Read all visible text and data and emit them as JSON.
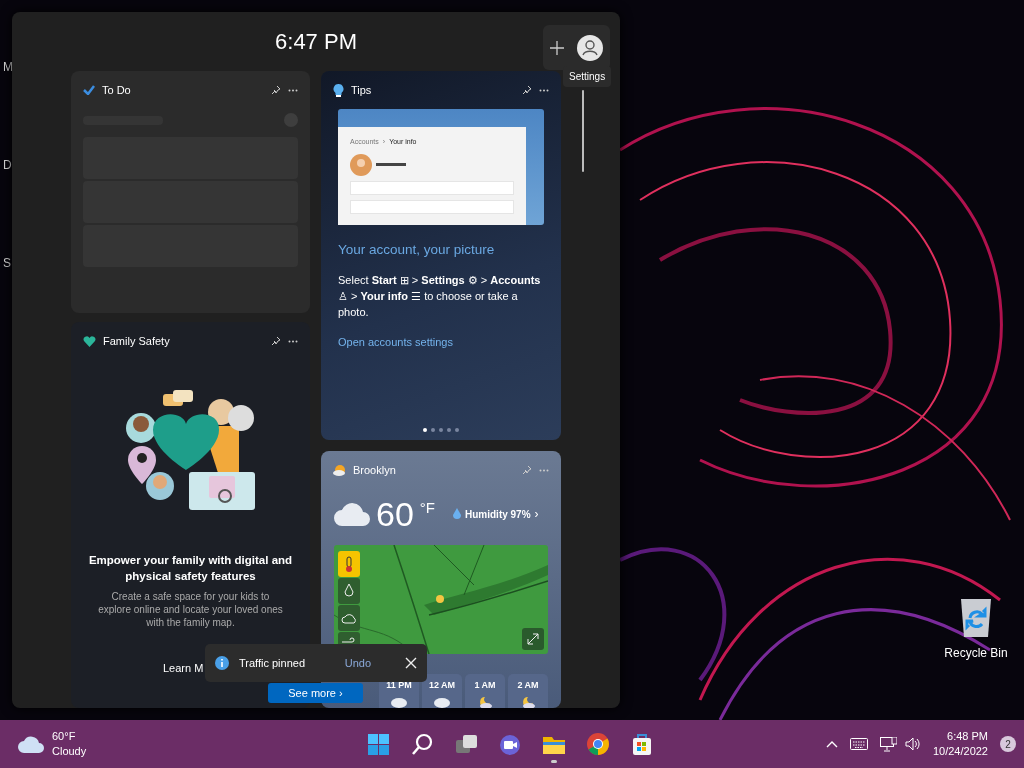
{
  "desktop": {
    "cut_labels": [
      "M",
      "D",
      "S"
    ],
    "icons": [
      {
        "label": "Recycle Bin"
      }
    ]
  },
  "widgets_panel": {
    "time": "6:47 PM",
    "tooltip": "Settings",
    "columns": [
      {
        "widgets": [
          {
            "kind": "todo",
            "title": "To Do"
          },
          {
            "kind": "family",
            "title": "Family Safety",
            "heading": "Empower your family with digital and physical safety features",
            "body": "Create a safe space for your kids to explore online and locate your loved ones with the family map.",
            "link": "Learn M",
            "button": "See more ›"
          }
        ]
      },
      {
        "widgets": [
          {
            "kind": "tips",
            "title": "Tips",
            "shot_crumb": "Accounts",
            "shot_sep": "›",
            "shot_page": "Your info",
            "headline": "Your account, your picture",
            "body": "Select **Start** ⊞ > **Settings** ⚙ > **Accounts** ♙ > **Your info** ☰ to choose or take a photo.",
            "link": "Open accounts settings",
            "pages": [
              {
                "selected": true
              },
              {
                "selected": false
              },
              {
                "selected": false
              },
              {
                "selected": false
              },
              {
                "selected": false
              }
            ]
          },
          {
            "kind": "weather",
            "title": "Brooklyn",
            "temp": "60",
            "unit": "°F",
            "humidity": "Humidity 97%",
            "chevron": "›",
            "map_layers": [
              {
                "kind": "temperature",
                "selected": true
              },
              {
                "kind": "precipitation",
                "selected": false
              },
              {
                "kind": "cloud",
                "selected": false
              },
              {
                "kind": "wind",
                "selected": false
              }
            ],
            "hourly": [
              {
                "time": "11 PM",
                "kind": "cloudy"
              },
              {
                "time": "12 AM",
                "kind": "cloudy"
              },
              {
                "time": "1 AM",
                "kind": "night"
              },
              {
                "time": "2 AM",
                "kind": "night"
              }
            ]
          }
        ]
      }
    ]
  },
  "toast": {
    "message": "Traffic pinned",
    "action": "Undo"
  },
  "taskbar": {
    "weather": {
      "temp": "60°F",
      "condition": "Cloudy"
    },
    "apps": [
      {
        "kind": "start",
        "running": false
      },
      {
        "kind": "search",
        "running": false
      },
      {
        "kind": "task-view",
        "running": false
      },
      {
        "kind": "chat",
        "running": false
      },
      {
        "kind": "file-explorer",
        "running": true
      },
      {
        "kind": "browser",
        "running": false
      },
      {
        "kind": "store",
        "running": false
      }
    ],
    "clock": {
      "time": "6:48 PM",
      "date": "10/24/2022"
    },
    "notifications": "2"
  }
}
